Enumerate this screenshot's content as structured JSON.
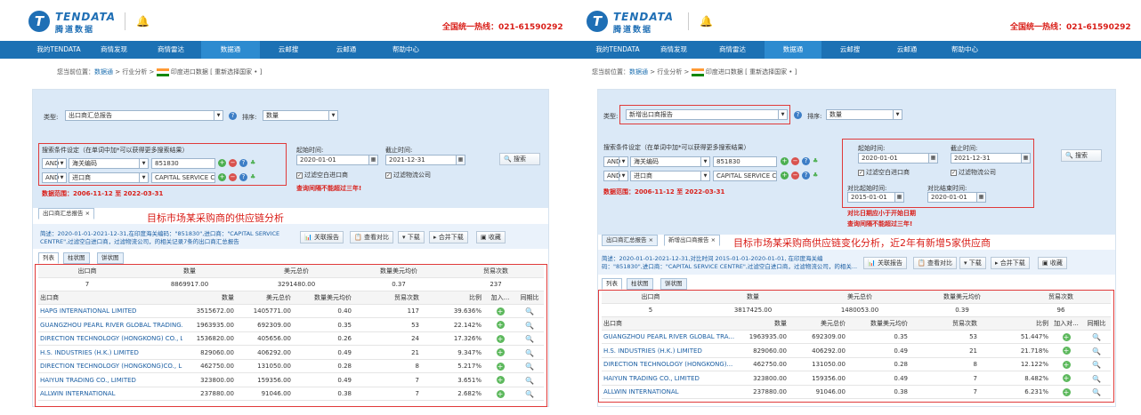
{
  "header": {
    "logo_en": "TENDATA",
    "logo_cn": "腾道数据",
    "hotline": "全国统一热线：021-61590292"
  },
  "nav": [
    "我的TENDATA",
    "商情发现",
    "商情雷达",
    "数据通",
    "云邮搜",
    "云邮通",
    "帮助中心"
  ],
  "crumb": {
    "prefix": "您当前位置：",
    "link": "数据通",
    "mid": " > 行业分析 > ",
    "country": "印度进口数据",
    "reselect": "[ 重新选择国家 • ]"
  },
  "left": {
    "type_label": "类型:",
    "type_value": "出口商汇总报告",
    "sort_label": "排序:",
    "sort_value": "数量",
    "cond_title": "搜索条件设定（在单词中加*可以获得更多搜索结果）",
    "cond": [
      {
        "op": "AND",
        "field": "海关编码",
        "value": "851830"
      },
      {
        "op": "AND",
        "field": "进口商",
        "value": "CAPITAL SERVICE CE"
      }
    ],
    "range_label": "数据范围：",
    "range": "2006-11-12 至 2022-03-31",
    "start_label": "起始时间:",
    "start": "2020-01-01",
    "end_label": "截止时间:",
    "end": "2021-12-31",
    "chk1": "过滤空白进口商",
    "chk2": "过滤物流公司",
    "note": "查询间隔不能超过三年!",
    "search": "搜索",
    "tab": "出口商汇总报告",
    "annotation": "目标市场某采购商的供应链分析",
    "desc": "简述：2020-01-01-2021-12-31,在印度海关编码：\"851830\",进口商：\"CAPITAL SERVICE CENTRE\",过滤空白进口商，过滤物流公司，的相关记录7条的出口商汇总报告",
    "actions": [
      "关联报告",
      "查看对比",
      "下载",
      "合并下载",
      "收藏"
    ],
    "views": [
      "列表",
      "柱状图",
      "饼状图"
    ],
    "summary_head": [
      "出口商",
      "数量",
      "美元总价",
      "数量美元均价",
      "贸易次数"
    ],
    "summary": [
      "7",
      "8869917.00",
      "3291480.00",
      "0.37",
      "237"
    ],
    "table_head": [
      "出口商",
      "数量",
      "美元总价",
      "数量美元均价",
      "贸易次数",
      "比例",
      "加入...",
      "同期比"
    ],
    "rows": [
      [
        "HAPG INTERNATIONAL LIMITED",
        "3515672.00",
        "1405771.00",
        "0.40",
        "117",
        "39.636%"
      ],
      [
        "GUANGZHOU PEARL RIVER GLOBAL TRADING...",
        "1963935.00",
        "692309.00",
        "0.35",
        "53",
        "22.142%"
      ],
      [
        "DIRECTION TECHNOLOGY (HONGKONG) CO., L...",
        "1536820.00",
        "405656.00",
        "0.26",
        "24",
        "17.326%"
      ],
      [
        "H.S. INDUSTRIES (H.K.) LIMITED",
        "829060.00",
        "406292.00",
        "0.49",
        "21",
        "9.347%"
      ],
      [
        "DIRECTION TECHNOLOGY (HONGKONG)CO., L...",
        "462750.00",
        "131050.00",
        "0.28",
        "8",
        "5.217%"
      ],
      [
        "HAIYUN TRADING CO., LIMITED",
        "323800.00",
        "159356.00",
        "0.49",
        "7",
        "3.651%"
      ],
      [
        "ALLWIN INTERNATIONAL",
        "237880.00",
        "91046.00",
        "0.38",
        "7",
        "2.682%"
      ]
    ]
  },
  "right": {
    "type_label": "类型:",
    "type_value": "新增出口商报告",
    "sort_label": "排序:",
    "sort_value": "数量",
    "cond_title": "搜索条件设定（在单词中加*可以获得更多搜索结果）",
    "cond": [
      {
        "op": "AND",
        "field": "海关编码",
        "value": "851830"
      },
      {
        "op": "AND",
        "field": "进口商",
        "value": "CAPITAL SERVICE CE"
      }
    ],
    "range_label": "数据范围：",
    "range": "2006-11-12 至 2022-03-31",
    "start_label": "起始时间:",
    "start": "2020-01-01",
    "end_label": "截止时间:",
    "end": "2021-12-31",
    "chk1": "过滤空白进口商",
    "chk2": "过滤物流公司",
    "cmp_start_label": "对比起始时间:",
    "cmp_start": "2015-01-01",
    "cmp_end_label": "对比结束时间:",
    "cmp_end": "2020-01-01",
    "note1": "对比日期应小于开始日期",
    "note2": "查询间隔不能超过三年!",
    "search": "搜索",
    "tab1": "出口商汇总报告",
    "tab2": "新增出口商报告",
    "annotation": "目标市场某采购商供应链变化分析，近2年有新增5家供应商",
    "desc": "简述：2020-01-01-2021-12-31,对比时间 2015-01-01-2020-01-01, 在印度海关编码：\"851830\",进口商：\"CAPITAL SERVICE CENTRE\",过滤空白进口商，过滤物流公司，的相关...",
    "actions": [
      "关联报告",
      "查看对比",
      "下载",
      "合并下载",
      "收藏"
    ],
    "views": [
      "列表",
      "柱状图",
      "饼状图"
    ],
    "summary_head": [
      "出口商",
      "数量",
      "美元总价",
      "数量美元均价",
      "贸易次数"
    ],
    "summary": [
      "5",
      "3817425.00",
      "1480053.00",
      "0.39",
      "96"
    ],
    "table_head": [
      "出口商",
      "数量",
      "美元总价",
      "数量美元均价",
      "贸易次数",
      "比例",
      "加入对...",
      "同期比"
    ],
    "rows": [
      [
        "GUANGZHOU PEARL RIVER GLOBAL TRA...",
        "1963935.00",
        "692309.00",
        "0.35",
        "53",
        "51.447%"
      ],
      [
        "H.S. INDUSTRIES (H.K.) LIMITED",
        "829060.00",
        "406292.00",
        "0.49",
        "21",
        "21.718%"
      ],
      [
        "DIRECTION TECHNOLOGY (HONGKONG)...",
        "462750.00",
        "131050.00",
        "0.28",
        "8",
        "12.122%"
      ],
      [
        "HAIYUN TRADING CO., LIMITED",
        "323800.00",
        "159356.00",
        "0.49",
        "7",
        "8.482%"
      ],
      [
        "ALLWIN INTERNATIONAL",
        "237880.00",
        "91046.00",
        "0.38",
        "7",
        "6.231%"
      ]
    ]
  }
}
